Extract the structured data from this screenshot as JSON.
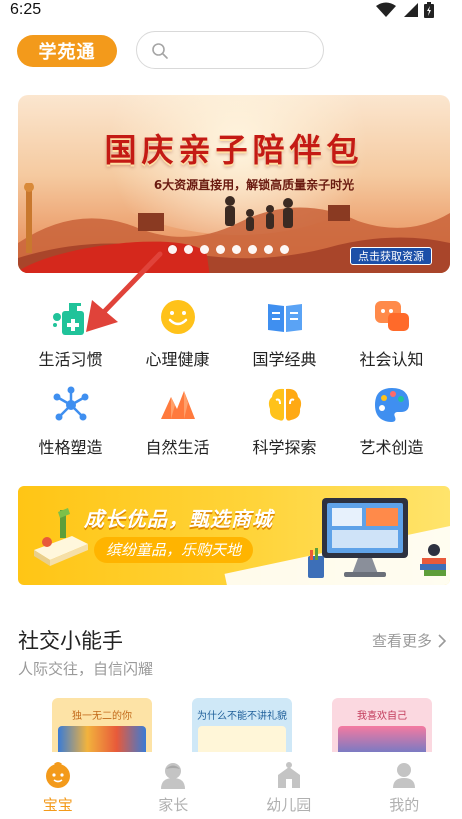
{
  "status_bar": {
    "time": "6:25"
  },
  "header": {
    "brand": "学苑通",
    "search_placeholder": ""
  },
  "hero": {
    "title": "国庆亲子陪伴包",
    "subtitle": "6大资源直接用，解锁高质量亲子时光",
    "cta": "点击获取资源",
    "slide_count": 8,
    "active_slide": 1
  },
  "categories": [
    {
      "label": "生活习惯",
      "icon": "hand-sanitizer-icon",
      "color": "#20c39a"
    },
    {
      "label": "心理健康",
      "icon": "smiley-icon",
      "color": "#ffc21a"
    },
    {
      "label": "国学经典",
      "icon": "open-book-icon",
      "color": "#3f8ff0"
    },
    {
      "label": "社会认知",
      "icon": "chat-bubbles-icon",
      "color": "#ff7a3d"
    },
    {
      "label": "性格塑造",
      "icon": "network-icon",
      "color": "#3f8ff0"
    },
    {
      "label": "自然生活",
      "icon": "mountains-icon",
      "color": "#ff7a3d"
    },
    {
      "label": "科学探索",
      "icon": "brain-icon",
      "color": "#ffc21a"
    },
    {
      "label": "艺术创造",
      "icon": "palette-icon",
      "color": "#3f8ff0"
    }
  ],
  "mall_banner": {
    "title": "成长优品，甄选商城",
    "subtitle": "缤纷童品，乐购天地"
  },
  "social_section": {
    "title": "社交小能手",
    "subtitle": "人际交往，自信闪耀",
    "see_more": "查看更多",
    "books": [
      {
        "label": "独一无二的你",
        "bg": "#fde3a6",
        "label_color": "#c26a1a"
      },
      {
        "label": "为什么不能不讲礼貌",
        "bg": "#cfe8f7",
        "label_color": "#1f5f9a"
      },
      {
        "label": "我喜欢自己",
        "bg": "#fbd8e0",
        "label_color": "#c23a5a"
      }
    ]
  },
  "bottom_nav": [
    {
      "label": "宝宝",
      "icon": "baby-face-icon",
      "active": true
    },
    {
      "label": "家长",
      "icon": "parent-avatar-icon",
      "active": false
    },
    {
      "label": "幼儿园",
      "icon": "kindergarten-building-icon",
      "active": false
    },
    {
      "label": "我的",
      "icon": "profile-icon",
      "active": false
    }
  ],
  "colors": {
    "accent": "#f39a1b",
    "inactive_nav": "#b0b0b0",
    "hero_title": "#c41a14",
    "pointer_arrow": "#e0433a"
  }
}
